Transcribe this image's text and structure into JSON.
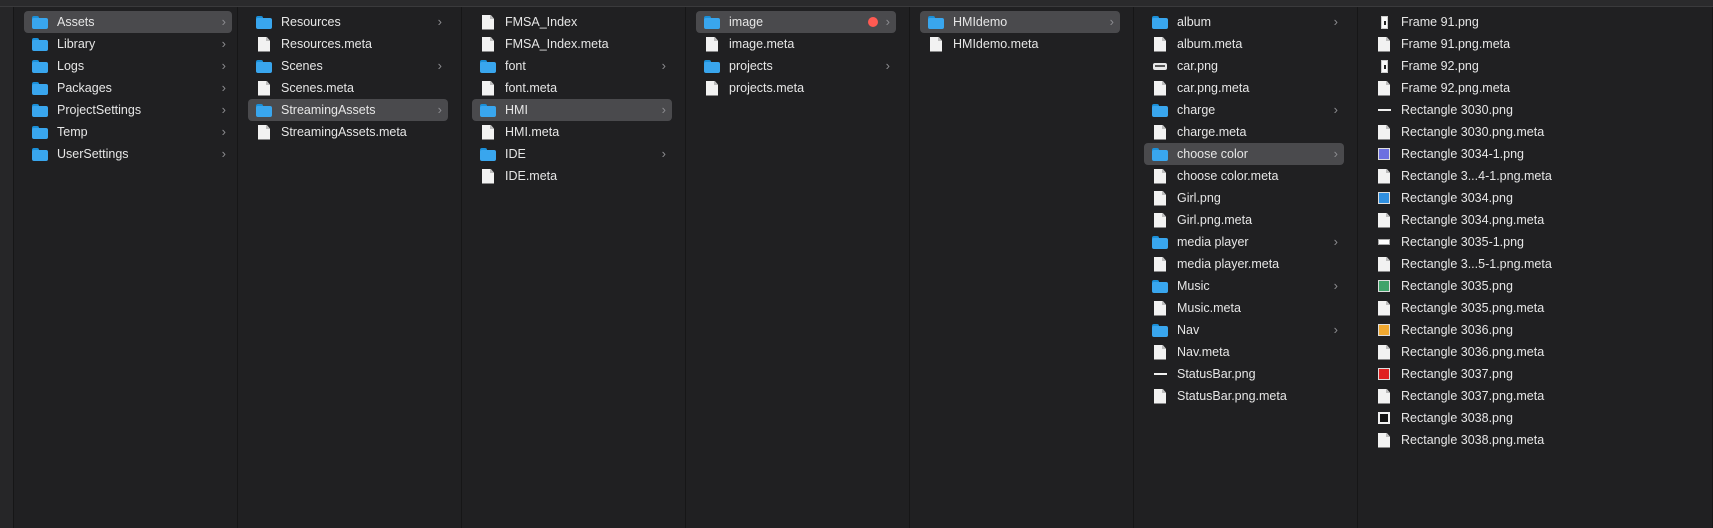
{
  "columns": [
    {
      "name": "col-project-root",
      "items": [
        {
          "label": "Assets",
          "kind": "folder",
          "selected": true,
          "chevron": true
        },
        {
          "label": "Library",
          "kind": "folder",
          "chevron": true
        },
        {
          "label": "Logs",
          "kind": "folder",
          "chevron": true
        },
        {
          "label": "Packages",
          "kind": "folder",
          "chevron": true
        },
        {
          "label": "ProjectSettings",
          "kind": "folder",
          "chevron": true
        },
        {
          "label": "Temp",
          "kind": "folder",
          "chevron": true
        },
        {
          "label": "UserSettings",
          "kind": "folder",
          "chevron": true
        }
      ]
    },
    {
      "name": "col-assets",
      "items": [
        {
          "label": "Resources",
          "kind": "folder",
          "chevron": true
        },
        {
          "label": "Resources.meta",
          "kind": "doc"
        },
        {
          "label": "Scenes",
          "kind": "folder",
          "chevron": true
        },
        {
          "label": "Scenes.meta",
          "kind": "doc"
        },
        {
          "label": "StreamingAssets",
          "kind": "folder",
          "selected": true,
          "chevron": true
        },
        {
          "label": "StreamingAssets.meta",
          "kind": "doc"
        }
      ]
    },
    {
      "name": "col-streaming-assets",
      "items": [
        {
          "label": "FMSA_Index",
          "kind": "doc"
        },
        {
          "label": "FMSA_Index.meta",
          "kind": "doc"
        },
        {
          "label": "font",
          "kind": "folder",
          "chevron": true
        },
        {
          "label": "font.meta",
          "kind": "doc"
        },
        {
          "label": "HMI",
          "kind": "folder",
          "selected": true,
          "chevron": true
        },
        {
          "label": "HMI.meta",
          "kind": "doc"
        },
        {
          "label": "IDE",
          "kind": "folder",
          "chevron": true
        },
        {
          "label": "IDE.meta",
          "kind": "doc"
        }
      ]
    },
    {
      "name": "col-hmi",
      "items": [
        {
          "label": "image",
          "kind": "folder",
          "selected": true,
          "chevron": true,
          "tag": "#ff5a52"
        },
        {
          "label": "image.meta",
          "kind": "doc"
        },
        {
          "label": "projects",
          "kind": "folder",
          "chevron": true
        },
        {
          "label": "projects.meta",
          "kind": "doc"
        }
      ]
    },
    {
      "name": "col-image",
      "items": [
        {
          "label": "HMIdemo",
          "kind": "folder",
          "selected": true,
          "chevron": true
        },
        {
          "label": "HMIdemo.meta",
          "kind": "doc"
        }
      ]
    },
    {
      "name": "col-hmidemo",
      "items": [
        {
          "label": "album",
          "kind": "folder",
          "chevron": true
        },
        {
          "label": "album.meta",
          "kind": "doc"
        },
        {
          "label": "car.png",
          "kind": "thumb",
          "thumb": "car"
        },
        {
          "label": "car.png.meta",
          "kind": "doc"
        },
        {
          "label": "charge",
          "kind": "folder",
          "chevron": true
        },
        {
          "label": "charge.meta",
          "kind": "doc"
        },
        {
          "label": "choose color",
          "kind": "folder",
          "selected": true,
          "chevron": true
        },
        {
          "label": "choose color.meta",
          "kind": "doc"
        },
        {
          "label": "Girl.png",
          "kind": "doc"
        },
        {
          "label": "Girl.png.meta",
          "kind": "doc"
        },
        {
          "label": "media player",
          "kind": "folder",
          "chevron": true
        },
        {
          "label": "media player.meta",
          "kind": "doc"
        },
        {
          "label": "Music",
          "kind": "folder",
          "chevron": true
        },
        {
          "label": "Music.meta",
          "kind": "doc"
        },
        {
          "label": "Nav",
          "kind": "folder",
          "chevron": true
        },
        {
          "label": "Nav.meta",
          "kind": "doc"
        },
        {
          "label": "StatusBar.png",
          "kind": "thumb",
          "thumb": "line"
        },
        {
          "label": "StatusBar.png.meta",
          "kind": "doc"
        }
      ]
    },
    {
      "name": "col-choose-color",
      "items": [
        {
          "label": "Frame 91.png",
          "kind": "thumb",
          "thumb": "frame"
        },
        {
          "label": "Frame 91.png.meta",
          "kind": "doc"
        },
        {
          "label": "Frame 92.png",
          "kind": "thumb",
          "thumb": "frame"
        },
        {
          "label": "Frame 92.png.meta",
          "kind": "doc"
        },
        {
          "label": "Rectangle 3030.png",
          "kind": "thumb",
          "thumb": "line"
        },
        {
          "label": "Rectangle 3030.png.meta",
          "kind": "doc"
        },
        {
          "label": "Rectangle 3034-1.png",
          "kind": "thumb",
          "thumb": "swatch",
          "color": "#6b6fe0"
        },
        {
          "label": "Rectangle 3...4-1.png.meta",
          "kind": "doc"
        },
        {
          "label": "Rectangle 3034.png",
          "kind": "thumb",
          "thumb": "swatch",
          "color": "#2f8fe0"
        },
        {
          "label": "Rectangle 3034.png.meta",
          "kind": "doc"
        },
        {
          "label": "Rectangle 3035-1.png",
          "kind": "thumb",
          "thumb": "bar"
        },
        {
          "label": "Rectangle 3...5-1.png.meta",
          "kind": "doc"
        },
        {
          "label": "Rectangle 3035.png",
          "kind": "thumb",
          "thumb": "swatch",
          "color": "#3fa36a"
        },
        {
          "label": "Rectangle 3035.png.meta",
          "kind": "doc"
        },
        {
          "label": "Rectangle 3036.png",
          "kind": "thumb",
          "thumb": "swatch",
          "color": "#f0a830"
        },
        {
          "label": "Rectangle 3036.png.meta",
          "kind": "doc"
        },
        {
          "label": "Rectangle 3037.png",
          "kind": "thumb",
          "thumb": "swatch",
          "color": "#e02020"
        },
        {
          "label": "Rectangle 3037.png.meta",
          "kind": "doc"
        },
        {
          "label": "Rectangle 3038.png",
          "kind": "thumb",
          "thumb": "outline"
        },
        {
          "label": "Rectangle 3038.png.meta",
          "kind": "doc"
        }
      ]
    }
  ]
}
